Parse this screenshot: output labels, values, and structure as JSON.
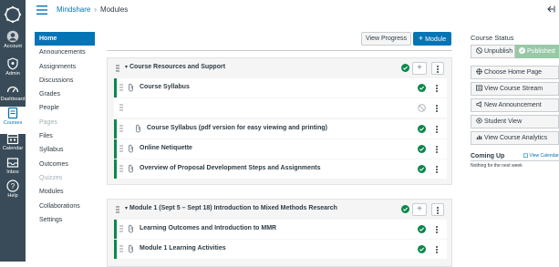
{
  "colors": {
    "nav_bg": "#394b58",
    "accent": "#0374b5",
    "published": "#0b874b",
    "published_btn": "#98c9a6"
  },
  "header": {
    "breadcrumb_course": "Mindshare",
    "breadcrumb_page": "Modules"
  },
  "global_nav": [
    {
      "label": "Account",
      "icon": "account-icon"
    },
    {
      "label": "Admin",
      "icon": "admin-icon"
    },
    {
      "label": "Dashboard",
      "icon": "dashboard-icon"
    },
    {
      "label": "Courses",
      "icon": "courses-icon",
      "active": true
    },
    {
      "label": "Calendar",
      "icon": "calendar-icon"
    },
    {
      "label": "Inbox",
      "icon": "inbox-icon"
    },
    {
      "label": "Help",
      "icon": "help-icon"
    }
  ],
  "course_nav": [
    {
      "label": "Home",
      "active": true
    },
    {
      "label": "Announcements"
    },
    {
      "label": "Assignments"
    },
    {
      "label": "Discussions"
    },
    {
      "label": "Grades"
    },
    {
      "label": "People"
    },
    {
      "label": "Pages",
      "disabled": true
    },
    {
      "label": "Files"
    },
    {
      "label": "Syllabus"
    },
    {
      "label": "Outcomes"
    },
    {
      "label": "Quizzes",
      "disabled": true
    },
    {
      "label": "Modules"
    },
    {
      "label": "Collaborations"
    },
    {
      "label": "Settings"
    }
  ],
  "toolbar": {
    "view_progress": "View Progress",
    "add_module": "Module"
  },
  "modules": [
    {
      "title": "Course Resources and Support",
      "items": [
        {
          "label": "Course Syllabus",
          "published": true,
          "indent": 0
        },
        {
          "label": "",
          "published": false,
          "indent": 0
        },
        {
          "label": "Course Syllabus (pdf version for easy viewing and printing)",
          "published": true,
          "indent": 1
        },
        {
          "label": "Online Netiquette",
          "published": true,
          "indent": 0
        },
        {
          "label": "Overview of Proposal Development Steps and Assignments",
          "published": true,
          "indent": 0
        }
      ]
    },
    {
      "title": "Module 1 (Sept 5 – Sept 18) Introduction to Mixed Methods Research",
      "items": [
        {
          "label": "Learning Outcomes and Introduction to MMR",
          "published": true,
          "indent": 0
        },
        {
          "label": "Module 1 Learning Activities",
          "published": true,
          "indent": 0
        }
      ]
    }
  ],
  "sidebar": {
    "status_title": "Course Status",
    "unpublish": "Unpublish",
    "published": "Published",
    "buttons": [
      {
        "label": "Choose Home Page",
        "icon": "home-page-icon"
      },
      {
        "label": "View Course Stream",
        "icon": "stream-icon"
      },
      {
        "label": "New Announcement",
        "icon": "announcement-icon"
      },
      {
        "label": "Student View",
        "icon": "student-view-icon"
      },
      {
        "label": "View Course Analytics",
        "icon": "analytics-icon"
      }
    ],
    "coming_up": "Coming Up",
    "view_calendar": "View Calendar",
    "nothing": "Nothing for the next week"
  }
}
